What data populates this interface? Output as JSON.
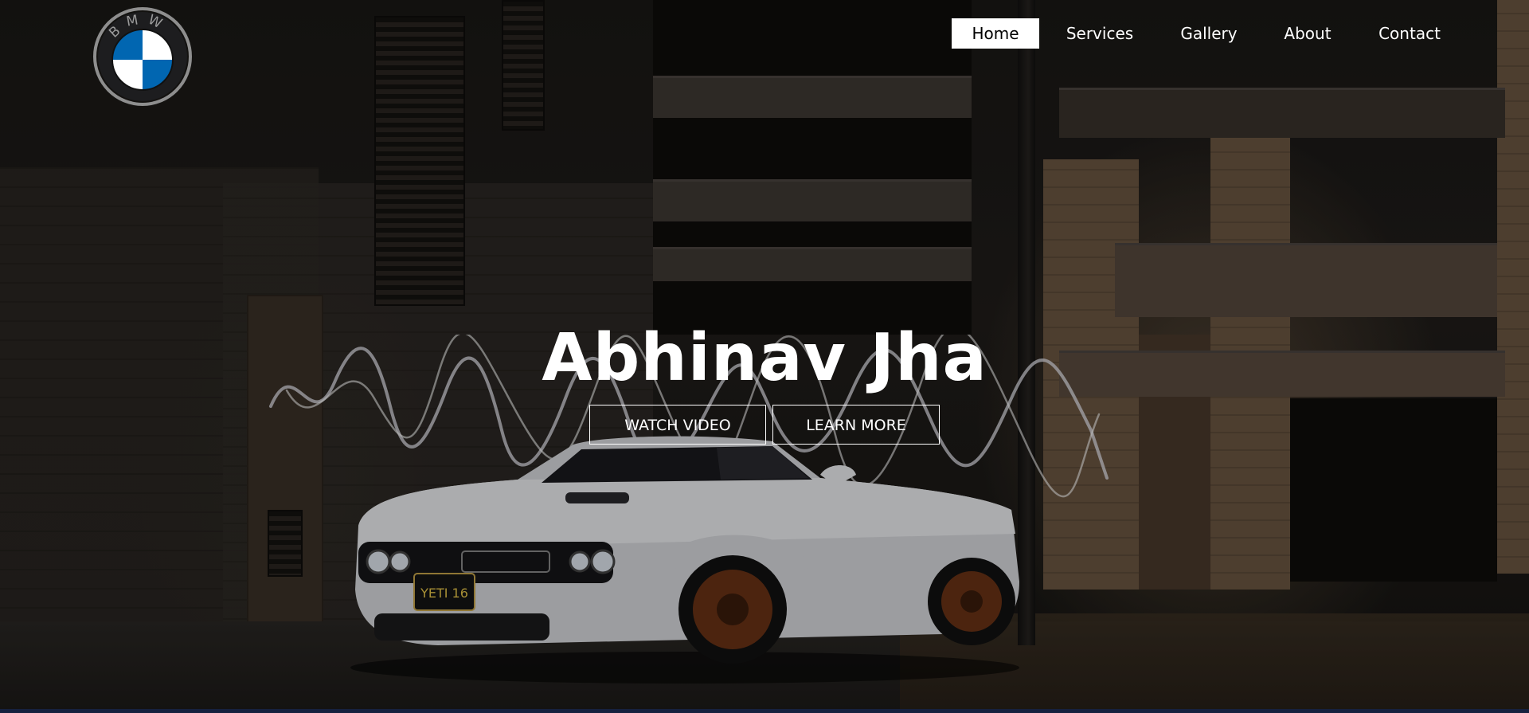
{
  "brand": {
    "logo_name": "bmw-logo",
    "logo_text": "BMW",
    "colors": {
      "blue": "#0166b1",
      "white": "#ffffff",
      "ring": "#9a9a9a"
    }
  },
  "nav": {
    "items": [
      {
        "label": "Home",
        "active": true
      },
      {
        "label": "Services",
        "active": false
      },
      {
        "label": "Gallery",
        "active": false
      },
      {
        "label": "About",
        "active": false
      },
      {
        "label": "Contact",
        "active": false
      }
    ]
  },
  "hero": {
    "title": "Abhinav Jha",
    "buttons": {
      "watch_video": "WATCH VIDEO",
      "learn_more": "LEARN MORE"
    },
    "license_plate": "YETI 16"
  },
  "colors": {
    "text": "#ffffff",
    "active_nav_bg": "#ffffff",
    "active_nav_text": "#000000",
    "bottom_bar": "#16213f"
  }
}
